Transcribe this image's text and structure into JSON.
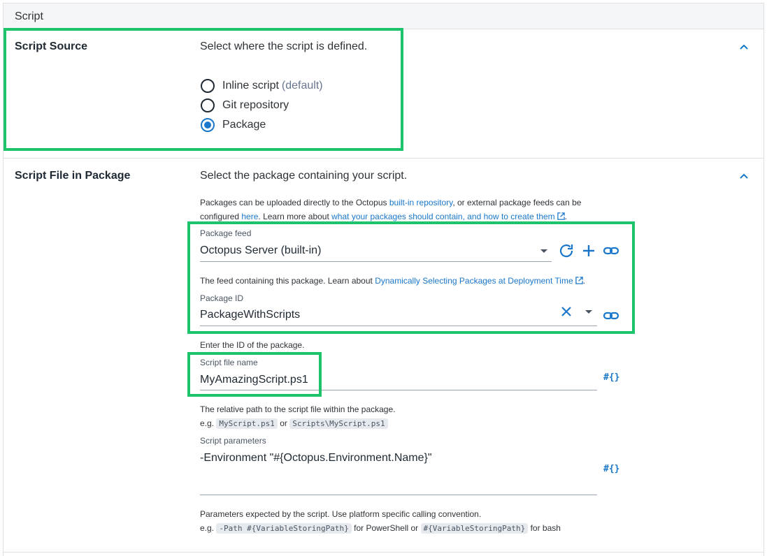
{
  "section": {
    "title": "Script"
  },
  "script_source": {
    "title": "Script Source",
    "description": "Select where the script is defined.",
    "options": [
      {
        "label": "Inline script",
        "suffix": "(default)",
        "checked": false
      },
      {
        "label": "Git repository",
        "suffix": "",
        "checked": false
      },
      {
        "label": "Package",
        "suffix": "",
        "checked": true
      }
    ]
  },
  "script_file": {
    "title": "Script File in Package",
    "description": "Select the package containing your script.",
    "help": {
      "t1": "Packages can be uploaded directly to the Octopus ",
      "link1": "built-in repository",
      "t2": ", or external package feeds can be configured ",
      "link2": "here",
      "t3": ". Learn more about ",
      "link3": "what your packages should contain, and how to create them",
      "t4": "."
    },
    "package_feed": {
      "label": "Package feed",
      "value": "Octopus Server (built-in)",
      "help_text": "The feed containing this package. Learn about ",
      "help_link": "Dynamically Selecting Packages at Deployment Time",
      "help_end": "."
    },
    "package_id": {
      "label": "Package ID",
      "value": "PackageWithScripts",
      "help": "Enter the ID of the package."
    },
    "script_file_name": {
      "label": "Script file name",
      "value": "MyAmazingScript.ps1",
      "help": "The relative path to the script file within the package.",
      "eg": "e.g.",
      "ex1": "MyScript.ps1",
      "or": "or",
      "ex2": "Scripts\\MyScript.ps1"
    },
    "script_parameters": {
      "label": "Script parameters",
      "value": "-Environment \"#{Octopus.Environment.Name}\"",
      "help": "Parameters expected by the script. Use platform specific calling convention.",
      "eg": "e.g.",
      "ex1": "-Path #{VariableStoringPath}",
      "mid": "for PowerShell or",
      "ex2": "#{VariableStoringPath}",
      "end": "for bash"
    },
    "variable_button": "#{}"
  },
  "colors": {
    "accent": "#1a77ca",
    "highlight": "#1dc46c"
  }
}
